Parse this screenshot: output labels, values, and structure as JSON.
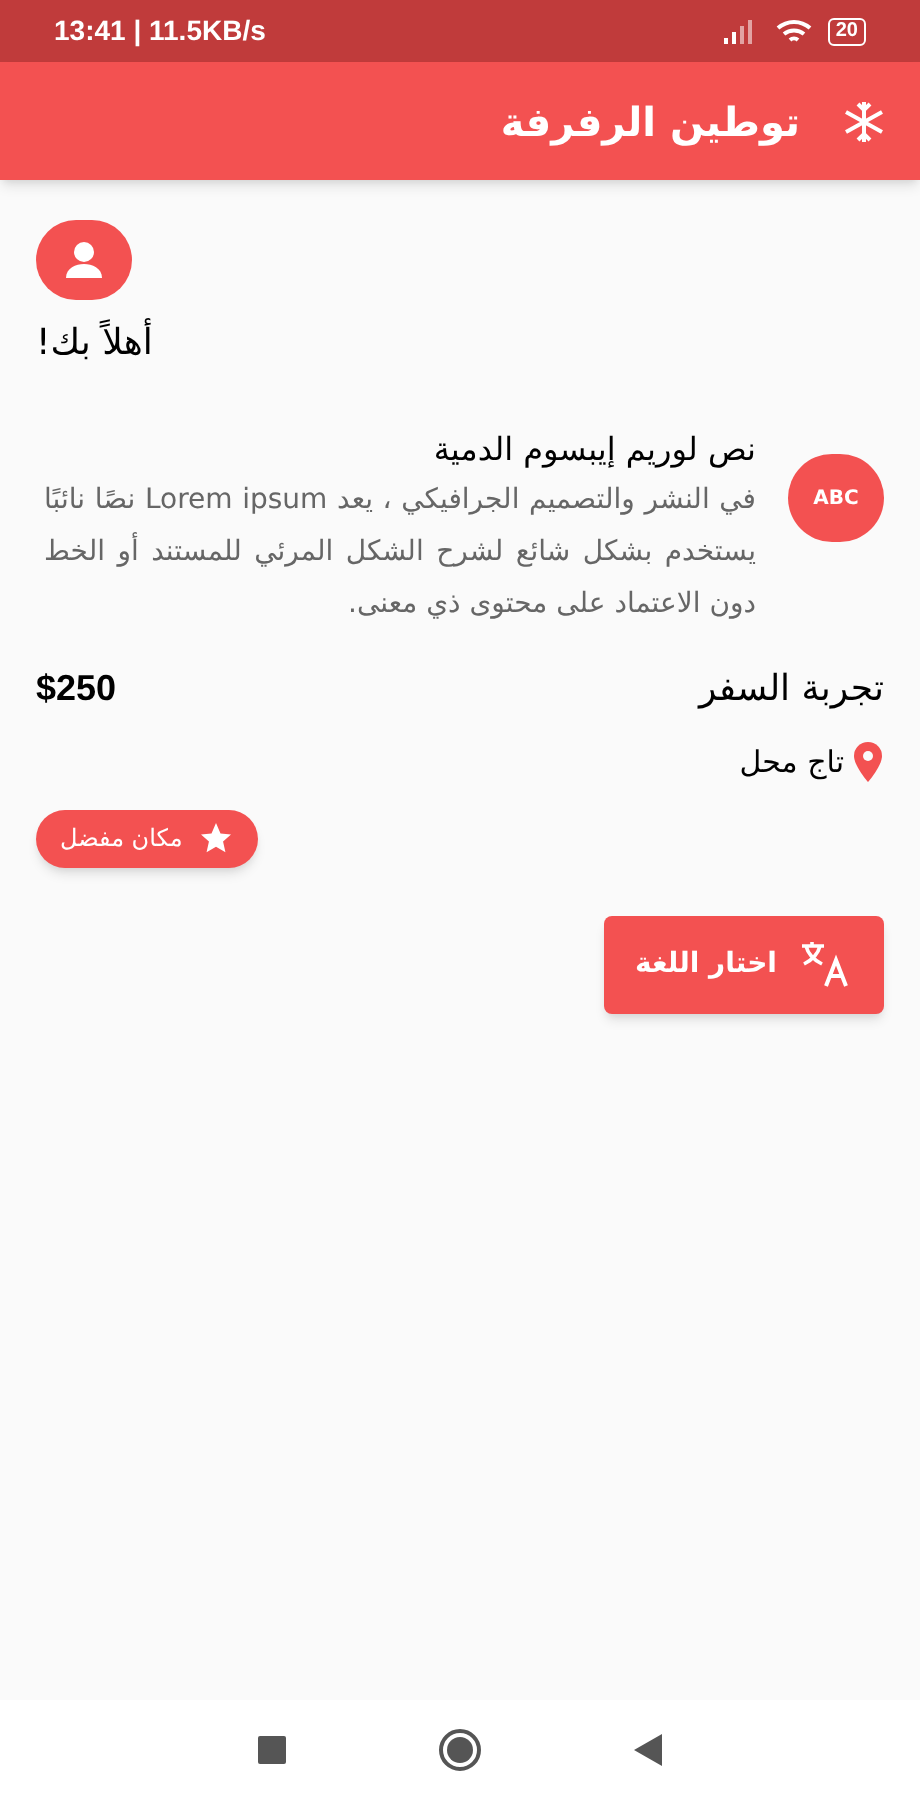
{
  "status_bar": {
    "time": "13:41 | 11.5KB/s",
    "battery": "20"
  },
  "app_bar": {
    "title": "توطين الرفرفة"
  },
  "greeting": "أهلاً بك!",
  "list_item": {
    "avatar_text": "ABC",
    "title": "نص لوريم إيبسوم الدمية",
    "body": "في النشر والتصميم الجرافيكي ، يعد Lorem ipsum نصًا نائبًا يستخدم بشكل شائع لشرح الشكل المرئي للمستند أو الخط دون الاعتماد على محتوى ذي معنى."
  },
  "place": {
    "title": "تجربة السفر",
    "price": "$250",
    "location": "تاج محل",
    "chip": "مكان مفضل"
  },
  "language_button": "اختار اللغة"
}
